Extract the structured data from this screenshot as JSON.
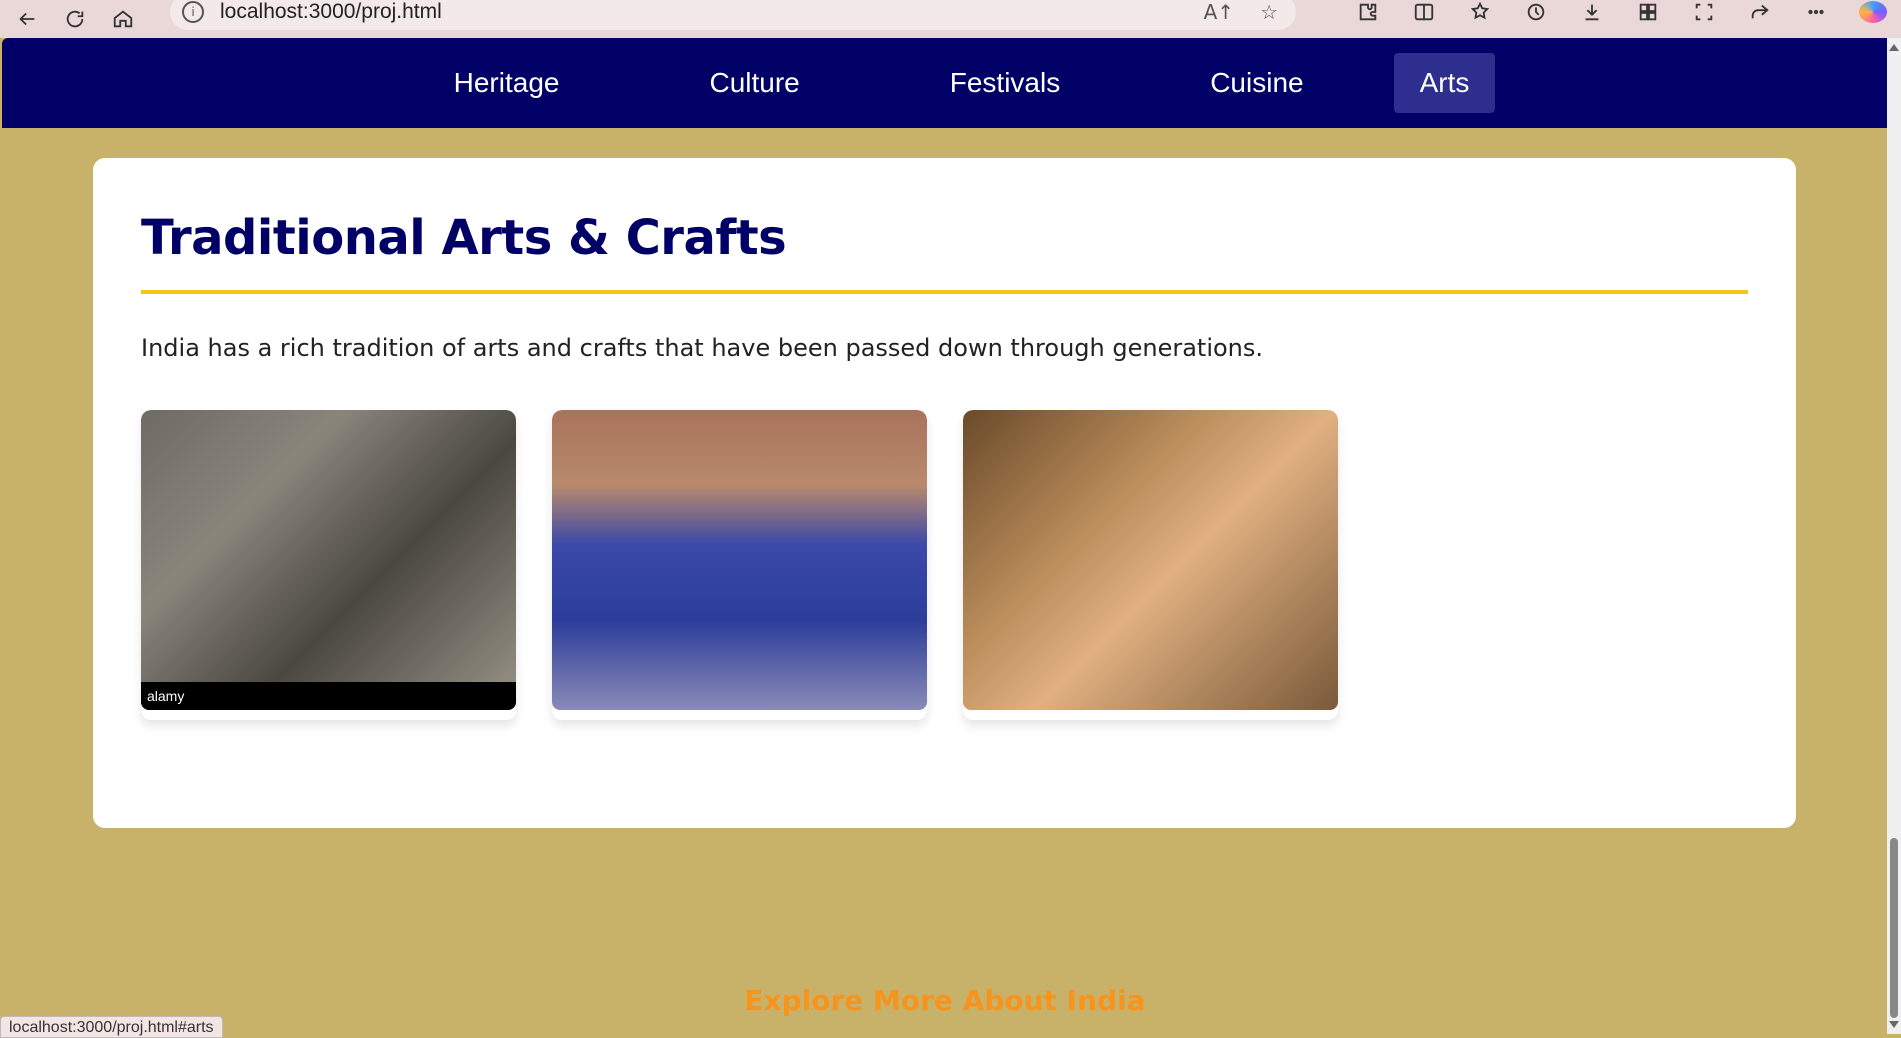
{
  "browser": {
    "url": "localhost:3000/proj.html",
    "read_aloud_label": "A↑",
    "status_url": "localhost:3000/proj.html#arts",
    "icons": [
      "back-icon",
      "refresh-icon",
      "home-icon",
      "info-icon",
      "read-aloud-icon",
      "favorite-star-icon",
      "extensions-icon",
      "split-screen-icon",
      "favorites-icon",
      "history-icon",
      "downloads-icon",
      "apps-icon",
      "screenshot-icon",
      "share-icon",
      "more-icon",
      "copilot-icon"
    ]
  },
  "nav": {
    "items": [
      {
        "label": "Heritage",
        "active": false
      },
      {
        "label": "Culture",
        "active": false
      },
      {
        "label": "Festivals",
        "active": false
      },
      {
        "label": "Cuisine",
        "active": false
      },
      {
        "label": "Arts",
        "active": true
      }
    ],
    "background": "#010066",
    "active_background": "#2e2e8f"
  },
  "section": {
    "title": "Traditional Arts & Crafts",
    "description": "India has a rich tradition of arts and crafts that have been passed down through generations.",
    "accent": "#f5c518",
    "gallery": [
      {
        "name": "stone-sculpture-image",
        "watermark": "alamy"
      },
      {
        "name": "blue-pottery-image",
        "watermark": ""
      },
      {
        "name": "handloom-weaving-image",
        "watermark": ""
      }
    ]
  },
  "footer": {
    "heading": "Explore More About India",
    "color": "#f7941d"
  },
  "colors": {
    "page_background": "#c8b26a",
    "title_color": "#010066"
  }
}
